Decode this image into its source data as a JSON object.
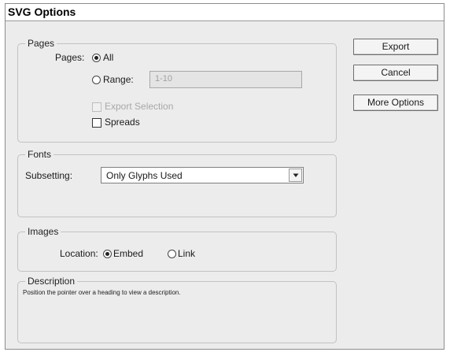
{
  "dialog": {
    "title": "SVG Options"
  },
  "pages": {
    "legend": "Pages",
    "pages_label": "Pages:",
    "all_label": "All",
    "range_label": "Range:",
    "range_value": "1-10",
    "export_selection_label": "Export Selection",
    "spreads_label": "Spreads",
    "selected": "All",
    "export_selection_enabled": false,
    "export_selection_checked": false,
    "spreads_checked": false
  },
  "fonts": {
    "legend": "Fonts",
    "subsetting_label": "Subsetting:",
    "subsetting_value": "Only Glyphs Used"
  },
  "images": {
    "legend": "Images",
    "location_label": "Location:",
    "embed_label": "Embed",
    "link_label": "Link",
    "selected": "Embed"
  },
  "description": {
    "legend": "Description",
    "text": "Position the pointer over a heading to view a description."
  },
  "buttons": {
    "export": "Export",
    "cancel": "Cancel",
    "more_options": "More Options"
  }
}
